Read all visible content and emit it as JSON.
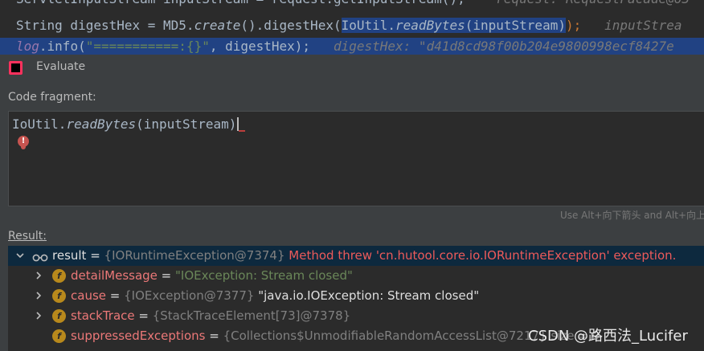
{
  "editor": {
    "line0_code": "ServletInputStream inputStream = request.getInputStream();",
    "line0_hint": "request: RequestFacade@63",
    "line1_prefix": "String digestHex = MD5.",
    "line1_create": "create",
    "line1_mid": "().digestHex(",
    "line1_sel_a": "IoUtil.",
    "line1_sel_b": "readBytes",
    "line1_sel_c": "(inputStream)",
    "line1_end": ");",
    "line1_hint": "inputStrea",
    "line2_log": "log",
    "line2_mid": ".info(",
    "line2_str": "\"===========:{}\"",
    "line2_end": ", digestHex);",
    "line2_hint": "digestHex: \"d41d8cd98f00b204e9800998ecf8427e"
  },
  "dialog": {
    "title": "Evaluate",
    "code_label": "Code fragment:",
    "fragment_a": "IoUtil.",
    "fragment_b": "readBytes",
    "fragment_c": "(inputStream)",
    "hint": "Use Alt+向下箭头 and Alt+向上",
    "result_label": "Result:"
  },
  "result": {
    "root_name": "result",
    "root_eq": " = ",
    "root_type": "{IORuntimeException@7374}",
    "root_msg": "Method threw 'cn.hutool.core.io.IORuntimeException' exception.",
    "children": [
      {
        "name": "detailMessage",
        "eq": " = ",
        "value": "\"IOException: Stream closed\""
      },
      {
        "name": "cause",
        "eq": " = ",
        "type": "{IOException@7377}",
        "value": "\"java.io.IOException: Stream closed\""
      },
      {
        "name": "stackTrace",
        "eq": " = ",
        "type": "{StackTraceElement[73]@7378}"
      },
      {
        "name": "suppressedExceptions",
        "eq": " = ",
        "type": "{Collections$UnmodifiableRandomAccessList@7217}",
        "extra": "size = 0"
      }
    ]
  },
  "watermark": "CSDN @路西法_Lucifer",
  "icons": {
    "app": "intellij-icon",
    "error": "error-bulb-icon",
    "watch": "glasses-icon",
    "field": "field-icon"
  }
}
